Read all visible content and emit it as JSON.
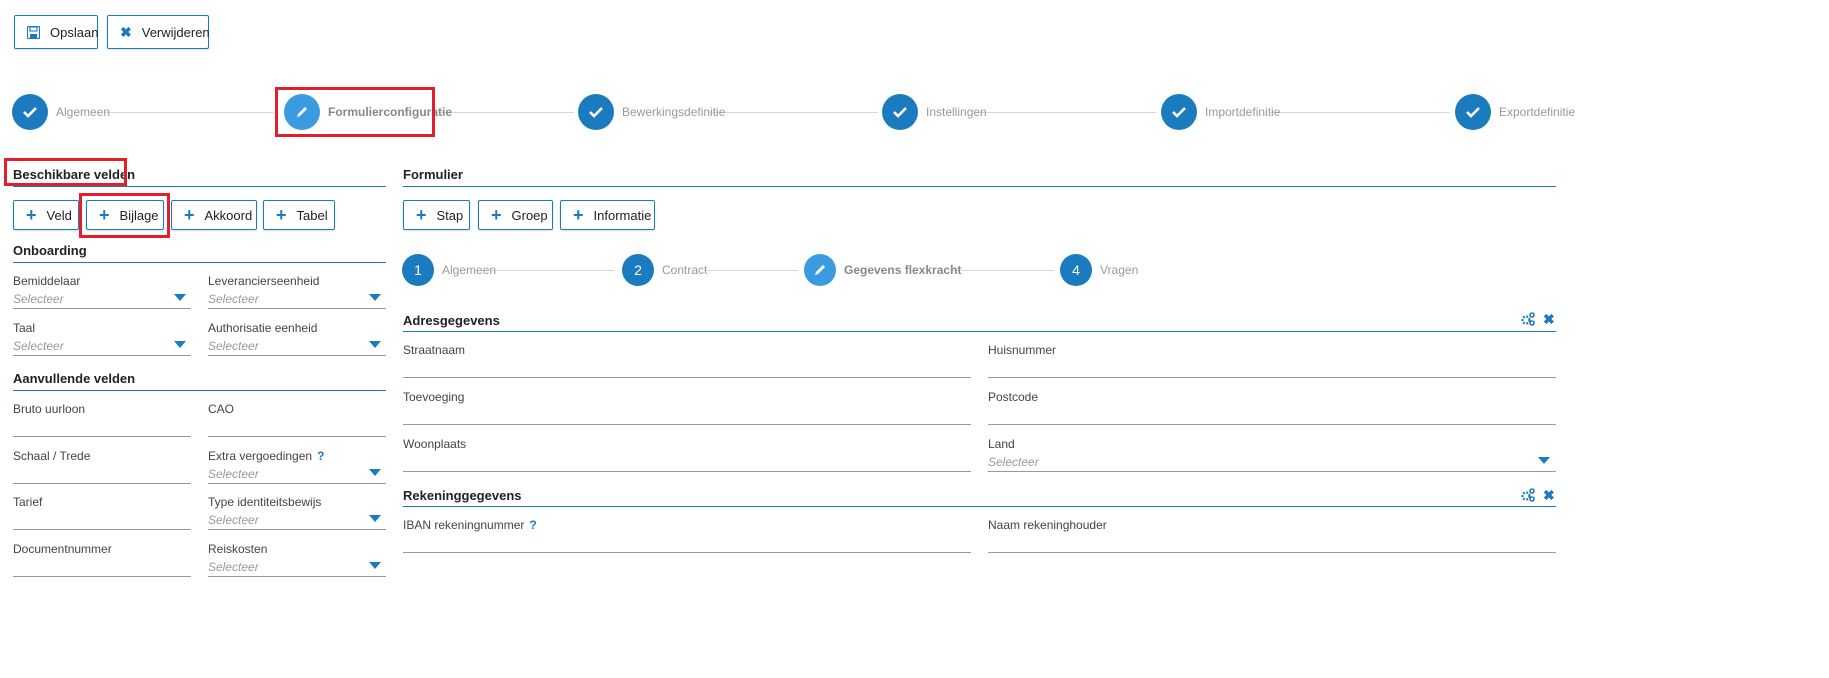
{
  "toolbar": {
    "save_label": "Opslaan",
    "delete_label": "Verwijderen"
  },
  "wizard": {
    "steps": [
      {
        "label": "Algemeen",
        "state": "done"
      },
      {
        "label": "Formulierconfiguratie",
        "state": "active"
      },
      {
        "label": "Bewerkingsdefinitie",
        "state": "done"
      },
      {
        "label": "Instellingen",
        "state": "done"
      },
      {
        "label": "Importdefinitie",
        "state": "done"
      },
      {
        "label": "Exportdefinitie",
        "state": "done"
      }
    ]
  },
  "available": {
    "title": "Beschikbare velden",
    "buttons": [
      "Veld",
      "Bijlage",
      "Akkoord",
      "Tabel"
    ],
    "onboarding": {
      "title": "Onboarding",
      "fields": [
        {
          "label": "Bemiddelaar",
          "placeholder": "Selecteer"
        },
        {
          "label": "Leverancierseenheid",
          "placeholder": "Selecteer"
        },
        {
          "label": "Taal",
          "placeholder": "Selecteer"
        },
        {
          "label": "Authorisatie eenheid",
          "placeholder": "Selecteer"
        }
      ]
    },
    "extra": {
      "title": "Aanvullende velden",
      "fields": [
        {
          "label": "Bruto uurloon"
        },
        {
          "label": "CAO"
        },
        {
          "label": "Schaal / Trede"
        },
        {
          "label": "Extra vergoedingen",
          "help": "?",
          "placeholder": "Selecteer"
        },
        {
          "label": "Tarief"
        },
        {
          "label": "Type identiteitsbewijs",
          "placeholder": "Selecteer"
        },
        {
          "label": "Documentnummer"
        },
        {
          "label": "Reiskosten",
          "placeholder": "Selecteer"
        }
      ]
    }
  },
  "form": {
    "title": "Formulier",
    "buttons": [
      "Stap",
      "Groep",
      "Informatie"
    ],
    "steps": [
      {
        "num": "1",
        "label": "Algemeen"
      },
      {
        "num": "2",
        "label": "Contract"
      },
      {
        "num": "",
        "label": "Gegevens flexkracht"
      },
      {
        "num": "4",
        "label": "Vragen"
      }
    ],
    "groups": [
      {
        "title": "Adresgegevens",
        "fields": [
          {
            "label": "Straatnaam"
          },
          {
            "label": "Huisnummer"
          },
          {
            "label": "Toevoeging"
          },
          {
            "label": "Postcode"
          },
          {
            "label": "Woonplaats"
          },
          {
            "label": "Land",
            "placeholder": "Selecteer"
          }
        ]
      },
      {
        "title": "Rekeninggegevens",
        "fields": [
          {
            "label": "IBAN rekeningnummer",
            "help": "?"
          },
          {
            "label": "Naam rekeninghouder"
          }
        ]
      }
    ]
  },
  "colors": {
    "accent": "#1b7bbf",
    "highlight": "#e3202a"
  }
}
